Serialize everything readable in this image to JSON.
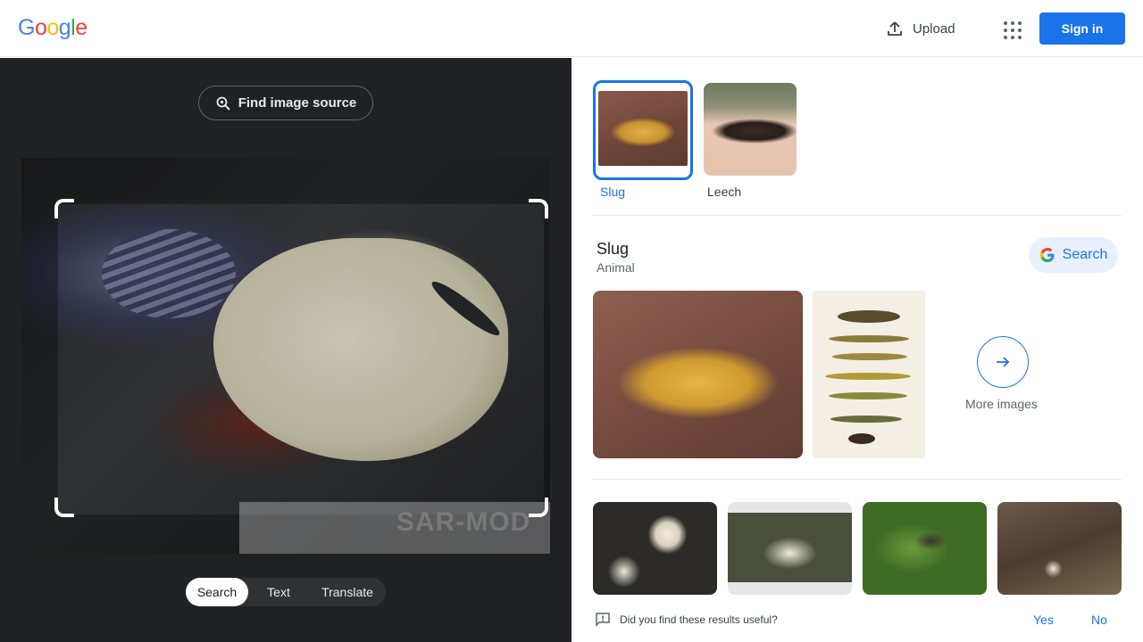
{
  "header": {
    "logo": [
      "G",
      "o",
      "o",
      "g",
      "l",
      "e"
    ],
    "logo_colors": [
      "#4285F4",
      "#EA4335",
      "#FBBC05",
      "#4285F4",
      "#34A853",
      "#EA4335"
    ],
    "upload_label": "Upload",
    "signin_label": "Sign in"
  },
  "left": {
    "find_source_label": "Find image source",
    "watermark_text": "SAR-MOD",
    "modes": [
      {
        "label": "Search",
        "active": true
      },
      {
        "label": "Text",
        "active": false
      },
      {
        "label": "Translate",
        "active": false
      }
    ]
  },
  "right": {
    "chips": [
      {
        "label": "Slug",
        "selected": true
      },
      {
        "label": "Leech",
        "selected": false
      }
    ],
    "entity": {
      "title": "Slug",
      "subtitle": "Animal",
      "search_label": "Search"
    },
    "more_images_label": "More images",
    "feedback": {
      "question": "Did you find these results useful?",
      "yes": "Yes",
      "no": "No"
    }
  },
  "colors": {
    "accent": "#1a73e8",
    "dark_panel": "#202124"
  }
}
